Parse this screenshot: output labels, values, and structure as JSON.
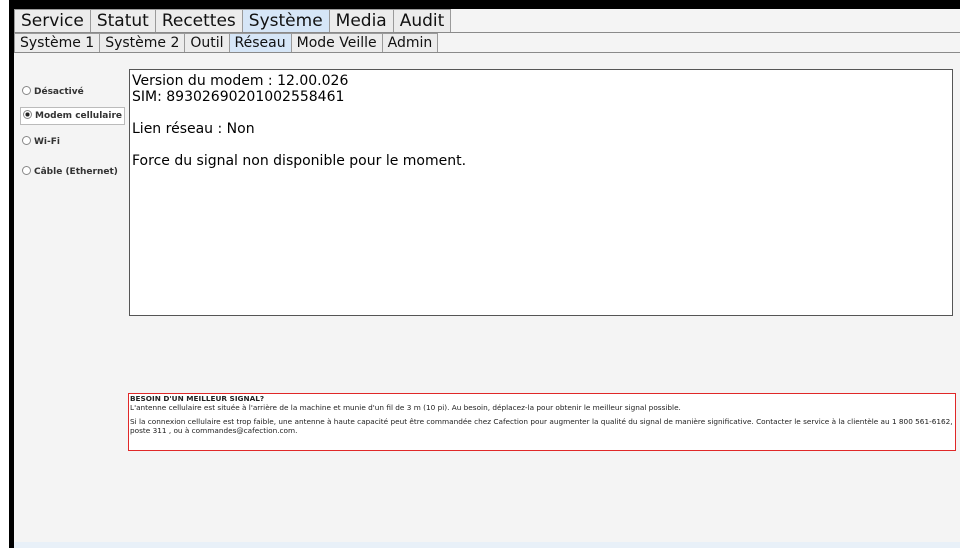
{
  "tabs": [
    "Service",
    "Statut",
    "Recettes",
    "Système",
    "Media",
    "Audit"
  ],
  "active_tab": "Système",
  "subtabs": [
    "Système 1",
    "Système 2",
    "Outil",
    "Réseau",
    "Mode Veille",
    "Admin"
  ],
  "active_subtab": "Réseau",
  "network_options": {
    "disabled": "Désactivé",
    "cellular": "Modem cellulaire",
    "wifi": "Wi-Fi",
    "ethernet": "Câble (Ethernet)",
    "selected": "Modem cellulaire"
  },
  "status": {
    "modem_version": "Version du modem : 12.00.026",
    "sim": "SIM: 89302690201002558461",
    "network_link": "Lien réseau : Non",
    "signal_strength": "Force du signal non disponible pour le moment."
  },
  "notice": {
    "title": "BESOIN D'UN MEILLEUR SIGNAL?",
    "line1": "L'antenne cellulaire est située à l'arrière de la machine et munie d'un fil de 3 m (10 pi). Au besoin, déplacez-la pour obtenir le meilleur signal possible.",
    "line2": "Si la connexion cellulaire est trop faible, une antenne à haute capacité peut être commandée chez Cafection pour augmenter la qualité du signal de manière significative. Contacter le service à la clientèle au 1 800 561-6162, poste 311 , ou à commandes@cafection.com."
  },
  "colors": {
    "active_tab": "#d6e6f7",
    "notice_border": "#e02828"
  }
}
